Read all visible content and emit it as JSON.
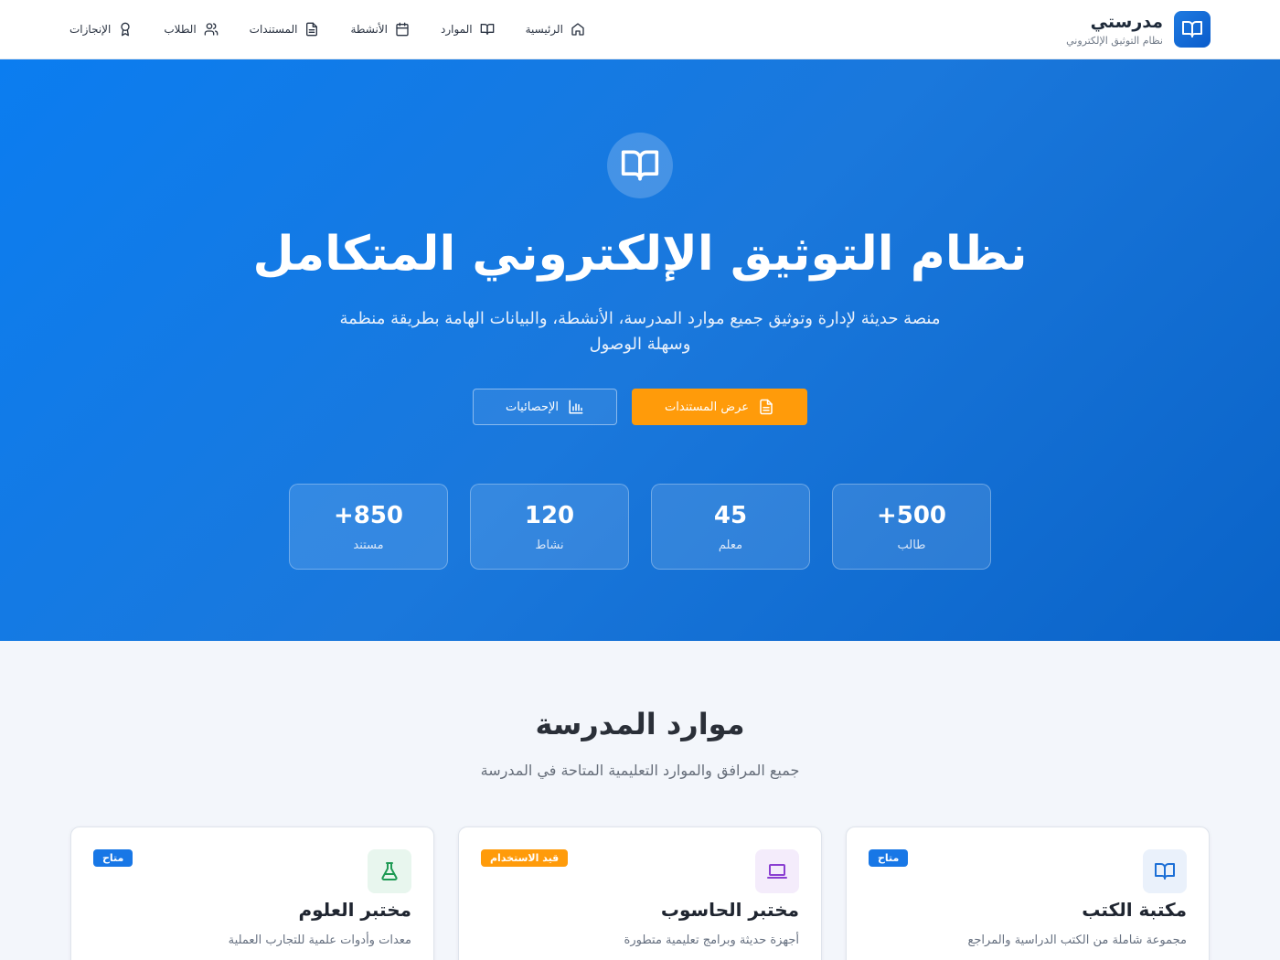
{
  "header": {
    "brand_title": "مدرستي",
    "brand_subtitle": "نظام التوثيق الإلكتروني",
    "nav": [
      {
        "label": "الرئيسية",
        "icon": "home-icon"
      },
      {
        "label": "الموارد",
        "icon": "book-open-icon"
      },
      {
        "label": "الأنشطة",
        "icon": "calendar-icon"
      },
      {
        "label": "المستندات",
        "icon": "document-icon"
      },
      {
        "label": "الطلاب",
        "icon": "users-icon"
      },
      {
        "label": "الإنجازات",
        "icon": "award-icon"
      }
    ]
  },
  "hero": {
    "title": "نظام التوثيق الإلكتروني المتكامل",
    "description": "منصة حديثة لإدارة وتوثيق جميع موارد المدرسة، الأنشطة، والبيانات الهامة بطريقة منظمة وسهلة الوصول",
    "primary_button": "عرض المستندات",
    "secondary_button": "الإحصائيات",
    "stats": [
      {
        "value": "+500",
        "label": "طالب"
      },
      {
        "value": "45",
        "label": "معلم"
      },
      {
        "value": "120",
        "label": "نشاط"
      },
      {
        "value": "+850",
        "label": "مستند"
      }
    ]
  },
  "resources": {
    "title": "موارد المدرسة",
    "subtitle": "جميع المرافق والموارد التعليمية المتاحة في المدرسة",
    "cards": [
      {
        "title": "مكتبة الكتب",
        "description": "مجموعة شاملة من الكتب الدراسية والمراجع",
        "badge": "متاح",
        "badge_color": "#1877e6",
        "icon": "book-open-icon",
        "icon_color": "#1c6fd6",
        "icon_bg": "#eaf1fb"
      },
      {
        "title": "مختبر الحاسوب",
        "description": "أجهزة حديثة وبرامج تعليمية متطورة",
        "badge": "قيد الاستخدام",
        "badge_color": "#ff9b0a",
        "icon": "laptop-icon",
        "icon_color": "#8a3fd1",
        "icon_bg": "#f4ecfb"
      },
      {
        "title": "مختبر العلوم",
        "description": "معدات وأدوات علمية للتجارب العملية",
        "badge": "متاح",
        "badge_color": "#1877e6",
        "icon": "flask-icon",
        "icon_color": "#1e9a54",
        "icon_bg": "#e8f6ee"
      }
    ]
  },
  "colors": {
    "primary": "#1877e6",
    "accent": "#ff9b0a"
  }
}
